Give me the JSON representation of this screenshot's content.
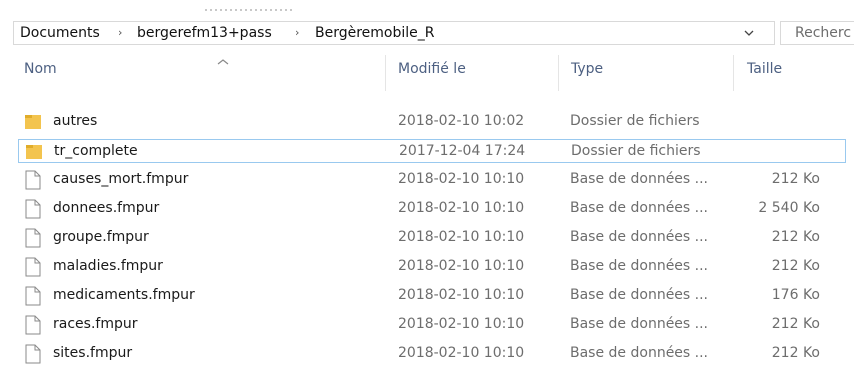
{
  "addressbar": {
    "crumbs": [
      "Documents",
      "bergerefm13+pass",
      "Bergèremobile_R"
    ],
    "separator": "›"
  },
  "search": {
    "placeholder": "Recherc"
  },
  "columns": {
    "name": "Nom",
    "modified": "Modifié le",
    "type": "Type",
    "size": "Taille"
  },
  "files": [
    {
      "name": "autres",
      "modified": "2018-02-10 10:02",
      "type": "Dossier de fichiers",
      "size": "",
      "icon": "folder-icon"
    },
    {
      "name": "tr_complete",
      "modified": "2017-12-04 17:24",
      "type": "Dossier de fichiers",
      "size": "",
      "icon": "folder-icon",
      "selected": true
    },
    {
      "name": "causes_mort.fmpur",
      "modified": "2018-02-10 10:10",
      "type": "Base de données ...",
      "size": "212 Ko",
      "icon": "file-icon"
    },
    {
      "name": "donnees.fmpur",
      "modified": "2018-02-10 10:10",
      "type": "Base de données ...",
      "size": "2 540 Ko",
      "icon": "file-icon"
    },
    {
      "name": "groupe.fmpur",
      "modified": "2018-02-10 10:10",
      "type": "Base de données ...",
      "size": "212 Ko",
      "icon": "file-icon"
    },
    {
      "name": "maladies.fmpur",
      "modified": "2018-02-10 10:10",
      "type": "Base de données ...",
      "size": "212 Ko",
      "icon": "file-icon"
    },
    {
      "name": "medicaments.fmpur",
      "modified": "2018-02-10 10:10",
      "type": "Base de données ...",
      "size": "176 Ko",
      "icon": "file-icon"
    },
    {
      "name": "races.fmpur",
      "modified": "2018-02-10 10:10",
      "type": "Base de données ...",
      "size": "212 Ko",
      "icon": "file-icon"
    },
    {
      "name": "sites.fmpur",
      "modified": "2018-02-10 10:10",
      "type": "Base de données ...",
      "size": "212 Ko",
      "icon": "file-icon"
    }
  ],
  "colors": {
    "folder": "#f3c44e",
    "header_text": "#4d6082",
    "selection_border": "#99c9ef"
  }
}
